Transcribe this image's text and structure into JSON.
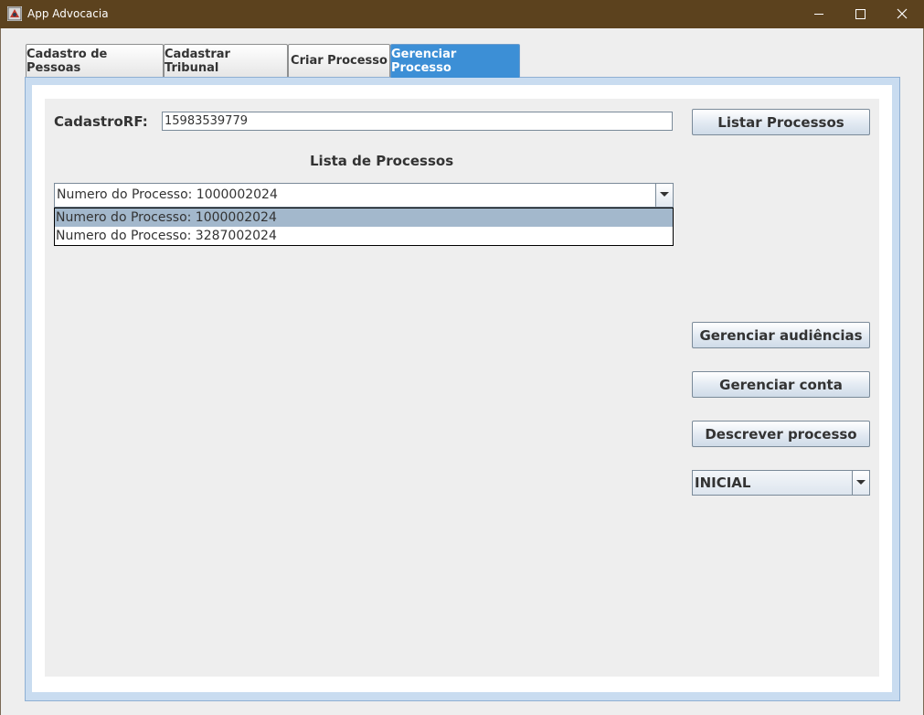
{
  "window": {
    "title": "App Advocacia",
    "title_bar_color": "#5c421e"
  },
  "tabs": [
    {
      "label": "Cadastro de Pessoas",
      "selected": false
    },
    {
      "label": "Cadastrar Tribunal",
      "selected": false
    },
    {
      "label": "Criar Processo",
      "selected": false
    },
    {
      "label": "Gerenciar Processo",
      "selected": true
    }
  ],
  "form": {
    "cadastro_label": "CadastroRF:",
    "cadastro_value": "15983539779",
    "listar_button": "Listar Processos",
    "lista_title": "Lista de Processos",
    "processo_selected": "Numero do Processo: 1000002024",
    "processo_options": [
      "Numero do Processo: 1000002024",
      "Numero do Processo: 3287002024"
    ],
    "audiencias_button": "Gerenciar audiências",
    "conta_button": "Gerenciar conta",
    "descrever_button": "Descrever processo",
    "status_selected": "INICIAL"
  },
  "colors": {
    "selected_tab": "#3c8fd6",
    "selected_list_item": "#a3b8cc"
  }
}
